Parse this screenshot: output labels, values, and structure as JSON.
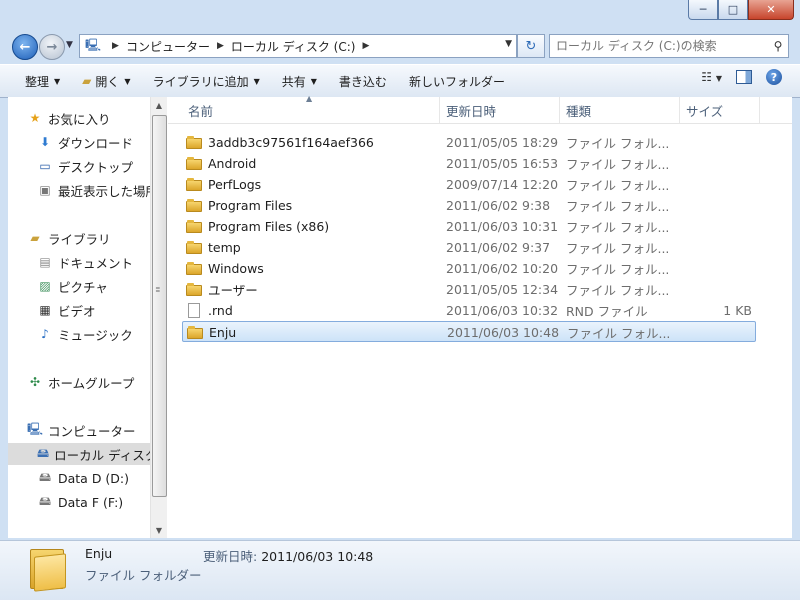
{
  "window": {
    "minimize": "─",
    "maximize": "□",
    "close": "✕"
  },
  "address": {
    "crumbs": [
      "コンピューター",
      "ローカル ディスク (C:)"
    ],
    "search_placeholder": "ローカル ディスク (C:)の検索"
  },
  "toolbar": {
    "organize": "整理",
    "open": "開く",
    "include_library": "ライブラリに追加",
    "share": "共有",
    "burn": "書き込む",
    "new_folder": "新しいフォルダー"
  },
  "nav": {
    "favorites": "お気に入り",
    "downloads": "ダウンロード",
    "desktop": "デスクトップ",
    "recent": "最近表示した場所",
    "libraries": "ライブラリ",
    "documents": "ドキュメント",
    "pictures": "ピクチャ",
    "videos": "ビデオ",
    "music": "ミュージック",
    "homegroup": "ホームグループ",
    "computer": "コンピューター",
    "local_disk": "ローカル ディスク (C:)",
    "data_d": "Data D (D:)",
    "data_f": "Data F (F:)"
  },
  "columns": {
    "name": "名前",
    "date": "更新日時",
    "type": "種類",
    "size": "サイズ"
  },
  "files": [
    {
      "name": "3addb3c97561f164aef366",
      "date": "2011/05/05 18:29",
      "type": "ファイル フォル...",
      "size": "",
      "kind": "folder"
    },
    {
      "name": "Android",
      "date": "2011/05/05 16:53",
      "type": "ファイル フォル...",
      "size": "",
      "kind": "folder"
    },
    {
      "name": "PerfLogs",
      "date": "2009/07/14 12:20",
      "type": "ファイル フォル...",
      "size": "",
      "kind": "folder"
    },
    {
      "name": "Program Files",
      "date": "2011/06/02 9:38",
      "type": "ファイル フォル...",
      "size": "",
      "kind": "folder"
    },
    {
      "name": "Program Files (x86)",
      "date": "2011/06/03 10:31",
      "type": "ファイル フォル...",
      "size": "",
      "kind": "folder"
    },
    {
      "name": "temp",
      "date": "2011/06/02 9:37",
      "type": "ファイル フォル...",
      "size": "",
      "kind": "folder"
    },
    {
      "name": "Windows",
      "date": "2011/06/02 10:20",
      "type": "ファイル フォル...",
      "size": "",
      "kind": "folder"
    },
    {
      "name": "ユーザー",
      "date": "2011/05/05 12:34",
      "type": "ファイル フォル...",
      "size": "",
      "kind": "folder"
    },
    {
      "name": ".rnd",
      "date": "2011/06/03 10:32",
      "type": "RND ファイル",
      "size": "1 KB",
      "kind": "file"
    },
    {
      "name": "Enju",
      "date": "2011/06/03 10:48",
      "type": "ファイル フォル...",
      "size": "",
      "kind": "folder"
    }
  ],
  "details": {
    "name": "Enju",
    "type": "ファイル フォルダー",
    "modified_label": "更新日時:",
    "modified_value": "2011/06/03 10:48"
  }
}
